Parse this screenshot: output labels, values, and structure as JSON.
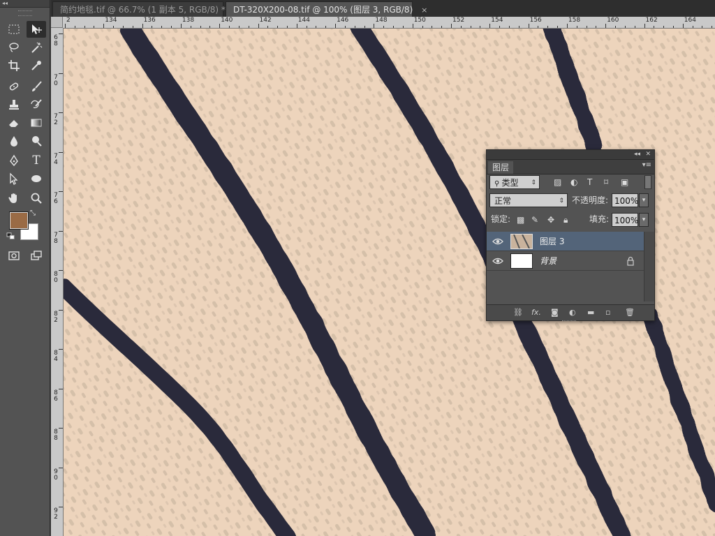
{
  "tabs": [
    {
      "label": "简约地毯.tif @ 66.7% (1 副本 5, RGB/8) *"
    },
    {
      "label": "DT-320X200-08.tif @ 100% (图层 3, RGB/8)"
    }
  ],
  "ruler": {
    "top": [
      "2",
      "134",
      "136",
      "138",
      "140",
      "142",
      "144",
      "146",
      "148",
      "150",
      "152",
      "154",
      "156",
      "158",
      "160",
      "162",
      "164"
    ],
    "left": [
      "6\n8",
      "7\n0",
      "7\n2",
      "7\n4",
      "7\n6",
      "7\n8",
      "8\n0",
      "8\n2",
      "8\n4",
      "8\n6",
      "8\n8",
      "9\n0",
      "9\n2"
    ]
  },
  "colors": {
    "foreground": "#9a6b45",
    "background": "#ffffff",
    "selected_layer": "#536479"
  },
  "layers_panel": {
    "tab": "图层",
    "filter_label": "类型",
    "blend_mode": "正常",
    "opacity_label": "不透明度:",
    "opacity_value": "100%",
    "lock_label": "锁定:",
    "fill_label": "填充:",
    "fill_value": "100%",
    "layers": [
      {
        "name": "图层 3",
        "selected": true,
        "visible": true
      },
      {
        "name": "背景",
        "selected": false,
        "visible": true,
        "locked": true
      }
    ],
    "bottom_icons": [
      "link-icon",
      "fx-icon",
      "mask-icon",
      "adjustment-icon",
      "group-icon",
      "new-layer-icon",
      "trash-icon"
    ],
    "fx_label": "fx."
  }
}
